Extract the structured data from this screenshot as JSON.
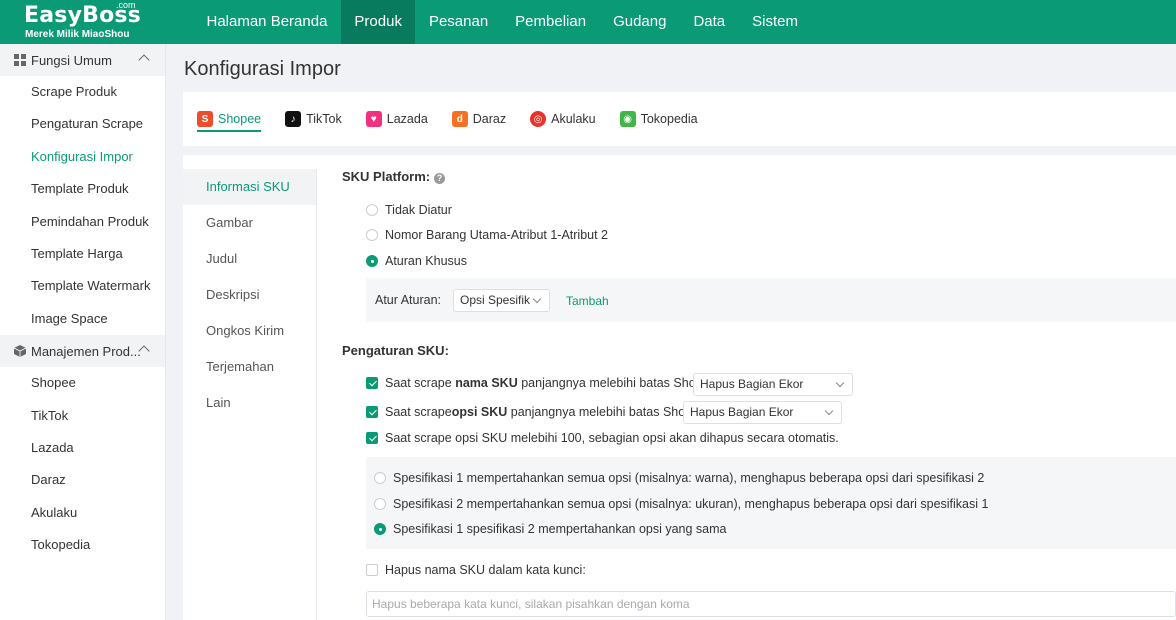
{
  "logo": {
    "brand": "EasyBoss",
    "com": ".com",
    "tagline": "Merek Milik MiaoShou"
  },
  "nav": [
    "Halaman Beranda",
    "Produk",
    "Pesanan",
    "Pembelian",
    "Gudang",
    "Data",
    "Sistem"
  ],
  "nav_active_index": 1,
  "sidebar": {
    "group1": {
      "label": "Fungsi Umum",
      "icon": "grid-icon"
    },
    "group1_items": [
      "Scrape Produk",
      "Pengaturan Scrape",
      "Konfigurasi Impor",
      "Template Produk",
      "Pemindahan Produk",
      "Template Harga",
      "Template Watermark",
      "Image Space"
    ],
    "active_item": "Konfigurasi Impor",
    "group2": {
      "label": "Manajemen Prod...",
      "icon": "cube-icon"
    },
    "group2_items": [
      "Shopee",
      "TikTok",
      "Lazada",
      "Daraz",
      "Akulaku",
      "Tokopedia"
    ]
  },
  "page_title": "Konfigurasi Impor",
  "platform_tabs": [
    {
      "label": "Shopee",
      "icon": "shopee-icon",
      "color": "#ee4d2d",
      "active": true
    },
    {
      "label": "TikTok",
      "icon": "tiktok-icon",
      "color": "#111111",
      "active": false
    },
    {
      "label": "Lazada",
      "icon": "lazada-icon",
      "color": "#f5317f",
      "active": false
    },
    {
      "label": "Daraz",
      "icon": "daraz-icon",
      "color": "#f57224",
      "active": false
    },
    {
      "label": "Akulaku",
      "icon": "akulaku-icon",
      "color": "#e8322a",
      "active": false
    },
    {
      "label": "Tokopedia",
      "icon": "tokopedia-icon",
      "color": "#42b549",
      "active": false
    }
  ],
  "sub_menu": [
    "Informasi SKU",
    "Gambar",
    "Judul",
    "Deskripsi",
    "Ongkos Kirim",
    "Terjemahan",
    "Lain"
  ],
  "sku_platform": {
    "title": "SKU Platform:",
    "options": [
      "Tidak Diatur",
      "Nomor Barang Utama-Atribut 1-Atribut 2",
      "Aturan Khusus"
    ],
    "selected_index": 2,
    "rule_label": "Atur Aturan:",
    "rule_value": "Opsi Spesifik",
    "add_label": "Tambah"
  },
  "sku_settings": {
    "title": "Pengaturan SKU:",
    "row1": {
      "pre": "Saat scrape ",
      "bold": "nama SKU",
      "post": " panjangnya melebihi batas Shopee",
      "select": "Hapus Bagian Ekor",
      "checked": true
    },
    "row2": {
      "pre": "Saat scrape",
      "bold": "opsi SKU",
      "post": " panjangnya melebihi batas Shopee",
      "select": "Hapus Bagian Ekor",
      "checked": true
    },
    "row3": {
      "text": "Saat scrape opsi SKU melebihi 100, sebagian opsi akan dihapus secara otomatis.",
      "checked": true
    },
    "options": [
      "Spesifikasi 1 mempertahankan semua opsi (misalnya: warna), menghapus beberapa opsi dari spesifikasi 2",
      "Spesifikasi 2 mempertahankan semua opsi (misalnya: ukuran), menghapus beberapa opsi dari spesifikasi 1",
      "Spesifikasi 1 spesifikasi 2 mempertahankan opsi yang sama"
    ],
    "selected_option": 2,
    "keyword_label": "Hapus nama SKU dalam kata kunci:",
    "keyword_checked": false,
    "keyword_placeholder": "Hapus beberapa kata kunci, silakan pisahkan dengan koma"
  },
  "colors": {
    "primary": "#0b9a76",
    "nav_active": "#087b5f"
  }
}
